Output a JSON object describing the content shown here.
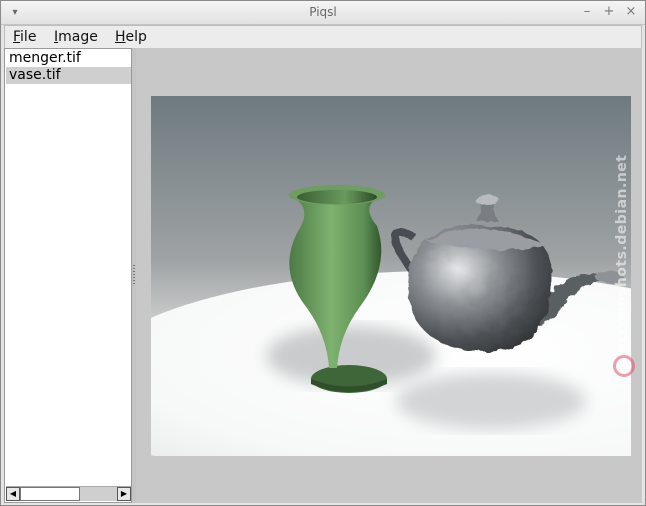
{
  "window": {
    "title": "Piqsl",
    "menu_glyph": "▾",
    "minimize_glyph": "–",
    "maximize_glyph": "+",
    "close_glyph": "×"
  },
  "menubar": {
    "items": [
      {
        "mnemonic": "F",
        "rest": "ile"
      },
      {
        "mnemonic": "I",
        "rest": "mage"
      },
      {
        "mnemonic": "H",
        "rest": "elp"
      }
    ]
  },
  "files": {
    "items": [
      "menger.tif",
      "vase.tif"
    ],
    "selected": "vase.tif"
  },
  "scrollbar": {
    "left_glyph": "◀",
    "right_glyph": "▶"
  },
  "watermark": {
    "text": "screenshots.debian.net"
  },
  "colors": {
    "vase": "#6a9a5e",
    "teapot": "#707478",
    "selection": "#cfcfcf"
  }
}
